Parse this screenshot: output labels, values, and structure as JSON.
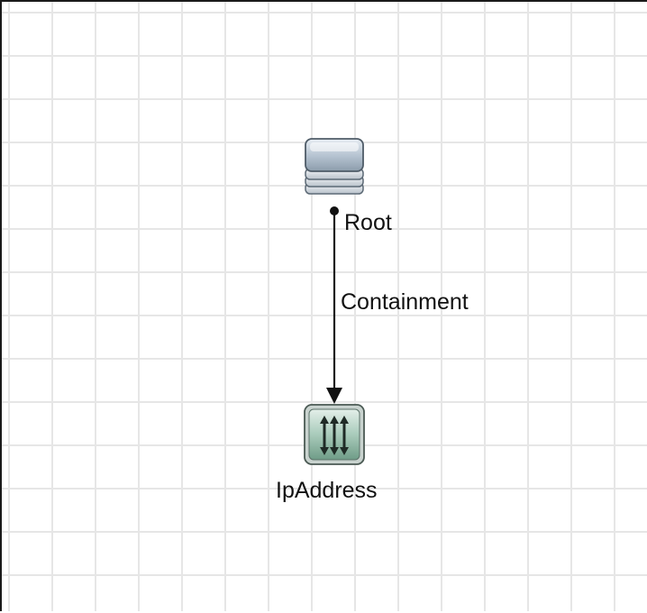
{
  "diagram": {
    "nodes": [
      {
        "id": "root",
        "label": "Root",
        "icon": "database-stack-icon"
      },
      {
        "id": "ipaddress",
        "label": "IpAddress",
        "icon": "ip-address-arrows-icon"
      }
    ],
    "edges": [
      {
        "from": "root",
        "to": "ipaddress",
        "label": "Containment",
        "directed": true
      }
    ]
  },
  "colors": {
    "grid_line": "#e6e6e6",
    "edge": "#1a1a1a",
    "root_icon": "#b8c6d4",
    "ip_icon": "#8fb8a6"
  }
}
